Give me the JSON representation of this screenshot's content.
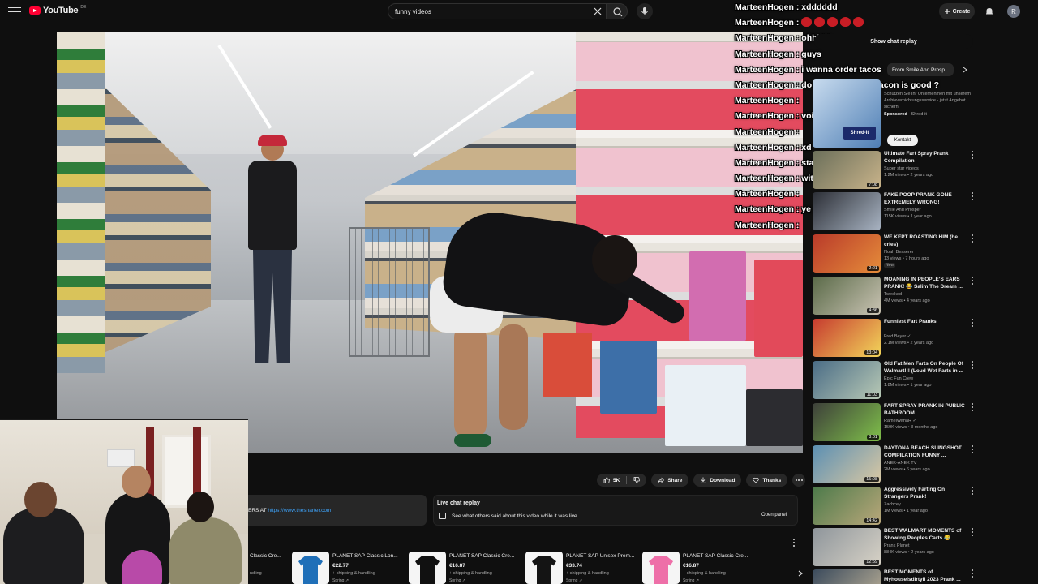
{
  "header": {
    "logo_text": "YouTube",
    "logo_region": "DE",
    "search_value": "funny videos",
    "create_label": "Create",
    "avatar_letter": "R"
  },
  "chat": [
    {
      "name": "MarteenHogen",
      "message": "xdddddd",
      "emotes": 0
    },
    {
      "name": "MarteenHogen",
      "message": "",
      "emotes": 5
    },
    {
      "name": "MarteenHogen",
      "message": "ohhhhh",
      "emotes": 0
    },
    {
      "name": "MarteenHogen",
      "message": "guys",
      "emotes": 0
    },
    {
      "name": "MarteenHogen",
      "message": "i wanna order tacos",
      "emotes": 0
    },
    {
      "name": "MarteenHogen",
      "message": "do you think with bacon is good ?",
      "emotes": 0
    },
    {
      "name": "MarteenHogen",
      "message": "",
      "emotes": 0
    },
    {
      "name": "MarteenHogen",
      "message": "voice is low",
      "emotes": 0
    },
    {
      "name": "MarteenHogen",
      "message": "",
      "emotes": 0
    },
    {
      "name": "MarteenHogen",
      "message": "xd",
      "emotes": 0
    },
    {
      "name": "MarteenHogen",
      "message": "standard",
      "emotes": 0
    },
    {
      "name": "MarteenHogen",
      "message": "with meat and mole",
      "emotes": 0
    },
    {
      "name": "MarteenHogen",
      "message": "",
      "emotes": 0
    },
    {
      "name": "MarteenHogen",
      "message": "ye ye",
      "emotes": 0
    },
    {
      "name": "MarteenHogen",
      "message": "",
      "emotes": 0
    }
  ],
  "sidebar": {
    "show_chat_label": "Show chat replay",
    "chips": [
      "From Smile And Prosp..."
    ],
    "ad": {
      "logo": "Shred-it",
      "text": "Schützen Sie Ihr Unternehmen mit unserem Archivvernichtungsservice - jetzt Angebot sichern!",
      "sponsored": "Sponsored",
      "advertiser": "Shred-it",
      "button": "Kontakt"
    },
    "recommendations": [
      {
        "title": "Ultimate Fart Spray Prank Compilation",
        "channel": "Super star videos",
        "stats": "1.2M views • 2 years ago",
        "duration": "7:08",
        "new": "",
        "thumb_a": "#6b6f5a",
        "thumb_b": "#c8b38a"
      },
      {
        "title": "FAKE POOP PRANK GONE EXTREMELY WRONG!",
        "channel": "Smile And Prosper",
        "stats": "115K views • 1 year ago",
        "duration": "",
        "new": "",
        "thumb_a": "#2c2f36",
        "thumb_b": "#a8b3c2"
      },
      {
        "title": "WE KEPT ROASTING HIM (he cries)",
        "channel": "Noah Besserer",
        "stats": "13 views • 7 hours ago",
        "duration": "2:21",
        "new": "New",
        "thumb_a": "#b93a2a",
        "thumb_b": "#e58c3a"
      },
      {
        "title": "MOANING IN PEOPLE'S EARS PRANK! 😂 Salim The Dream ...",
        "channel": "Tweeked",
        "stats": "4M views • 4 years ago",
        "duration": "4:36",
        "new": "",
        "thumb_a": "#5a6a48",
        "thumb_b": "#c9c3b3"
      },
      {
        "title": "Funniest Fart Pranks",
        "channel": "Fred Beyer ✓",
        "stats": "2.1M views • 2 years ago",
        "duration": "13:04",
        "new": "",
        "thumb_a": "#c63a2f",
        "thumb_b": "#f2d55a"
      },
      {
        "title": "Old Fat Men Farts On People Of Walmart!!! (Loud Wet Farts in ...",
        "channel": "Epic Fun Crew",
        "stats": "1.8M views • 1 year ago",
        "duration": "11:03",
        "new": "",
        "thumb_a": "#4a6c86",
        "thumb_b": "#b8c9b5"
      },
      {
        "title": "FART SPRAY PRANK IN PUBLIC BATHROOM",
        "channel": "RamelWithaR ✓",
        "stats": "159K views • 3 months ago",
        "duration": "8:01",
        "new": "",
        "thumb_a": "#3d3f3a",
        "thumb_b": "#7fbf4a"
      },
      {
        "title": "DAYTONA BEACH SLINGSHOT COMPILATION FUNNY ...",
        "channel": "ANEK-ANEK TV",
        "stats": "2M views • 6 years ago",
        "duration": "15:08",
        "new": "",
        "thumb_a": "#5b8fb3",
        "thumb_b": "#d9c8a3"
      },
      {
        "title": "Aggressively Farting On Strangers Prank!",
        "channel": "Zachcey",
        "stats": "1M views • 1 year ago",
        "duration": "14:42",
        "new": "",
        "thumb_a": "#4c7a4a",
        "thumb_b": "#b9a77a"
      },
      {
        "title": "BEST WALMART MOMENTS of Showing Peoples Carts 😂 ...",
        "channel": "Prank Planet",
        "stats": "884K views • 2 years ago",
        "duration": "12:59",
        "new": "",
        "thumb_a": "#8e959b",
        "thumb_b": "#d7d2c6"
      },
      {
        "title": "BEST MOMENTS of Myhouseisdirtyll 2023 Prank ...",
        "channel": "",
        "stats": "",
        "duration": "",
        "new": "",
        "thumb_a": "#3a4a5c",
        "thumb_b": "#c2b59a"
      }
    ]
  },
  "actions": {
    "like_count": "5K",
    "share": "Share",
    "download": "Download",
    "thanks": "Thanks"
  },
  "description": {
    "prefix": "ERS AT ",
    "link": "https://www.thesharter.com"
  },
  "live_chat": {
    "title": "Live chat replay",
    "subtitle": "See what others said about this video while it was live.",
    "open": "Open panel"
  },
  "merch": [
    {
      "title": "Classic Cre...",
      "price": "",
      "ship": "ndling",
      "store": "",
      "color": "#1c1c1c"
    },
    {
      "title": "PLANET SAP Classic Lon...",
      "price": "€22.77",
      "ship": "+ shipping & handling",
      "store": "Spring ↗",
      "color": "#1f6fb8"
    },
    {
      "title": "PLANET SAP Classic Cre...",
      "price": "€16.87",
      "ship": "+ shipping & handling",
      "store": "Spring ↗",
      "color": "#111111"
    },
    {
      "title": "PLANET SAP Unisex Prem...",
      "price": "€33.74",
      "ship": "+ shipping & handling",
      "store": "Spring ↗",
      "color": "#141414"
    },
    {
      "title": "PLANET SAP Classic Cre...",
      "price": "€16.87",
      "ship": "+ shipping & handling",
      "store": "Spring ↗",
      "color": "#ee6fa8"
    }
  ],
  "colors": {
    "accent": "#ff0033",
    "link": "#3ea6ff",
    "emote": "#c81d25"
  }
}
